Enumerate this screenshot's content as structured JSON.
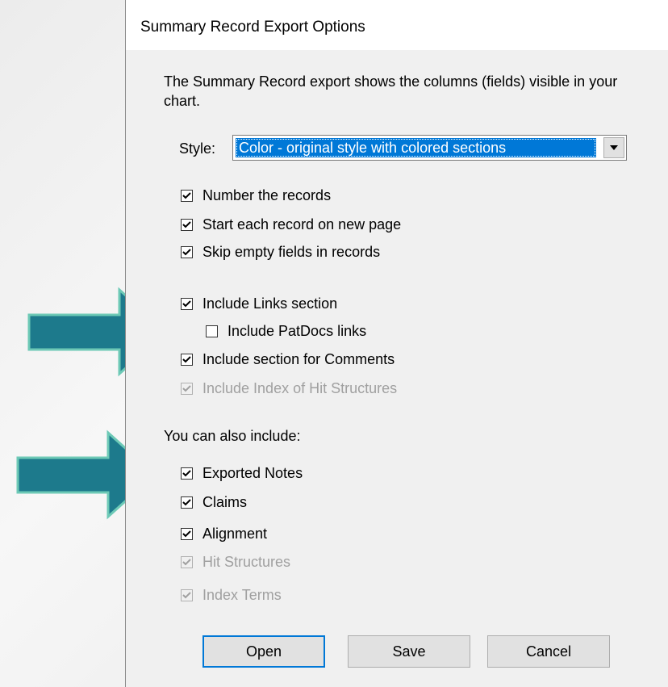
{
  "dialog": {
    "title": "Summary Record Export Options",
    "description": "The Summary Record export shows the columns (fields) visible in your chart.",
    "style_label": "Style:",
    "style_value": "Color - original style with colored sections"
  },
  "options_group1": [
    {
      "label": "Number the records",
      "checked": true,
      "enabled": true
    },
    {
      "label": "Start each record on new page",
      "checked": true,
      "enabled": true
    },
    {
      "label": "Skip empty fields in records",
      "checked": true,
      "enabled": true
    }
  ],
  "options_group2": [
    {
      "label": "Include Links section",
      "checked": true,
      "enabled": true
    },
    {
      "label": "Include PatDocs links",
      "checked": false,
      "enabled": true
    },
    {
      "label": "Include section for Comments",
      "checked": true,
      "enabled": true
    },
    {
      "label": "Include Index of Hit Structures",
      "checked": true,
      "enabled": false
    }
  ],
  "also_include_label": "You can also include:",
  "options_group3": [
    {
      "label": "Exported Notes",
      "checked": true,
      "enabled": true
    },
    {
      "label": "Claims",
      "checked": true,
      "enabled": true
    },
    {
      "label": "Alignment",
      "checked": true,
      "enabled": true
    },
    {
      "label": "Hit Structures",
      "checked": true,
      "enabled": false
    },
    {
      "label": "Index Terms",
      "checked": true,
      "enabled": false
    }
  ],
  "buttons": {
    "open": "Open",
    "save": "Save",
    "cancel": "Cancel"
  },
  "colors": {
    "arrow_fill": "#1d7a8c",
    "arrow_border": "#6dc9b6",
    "selection": "#0078d7"
  }
}
